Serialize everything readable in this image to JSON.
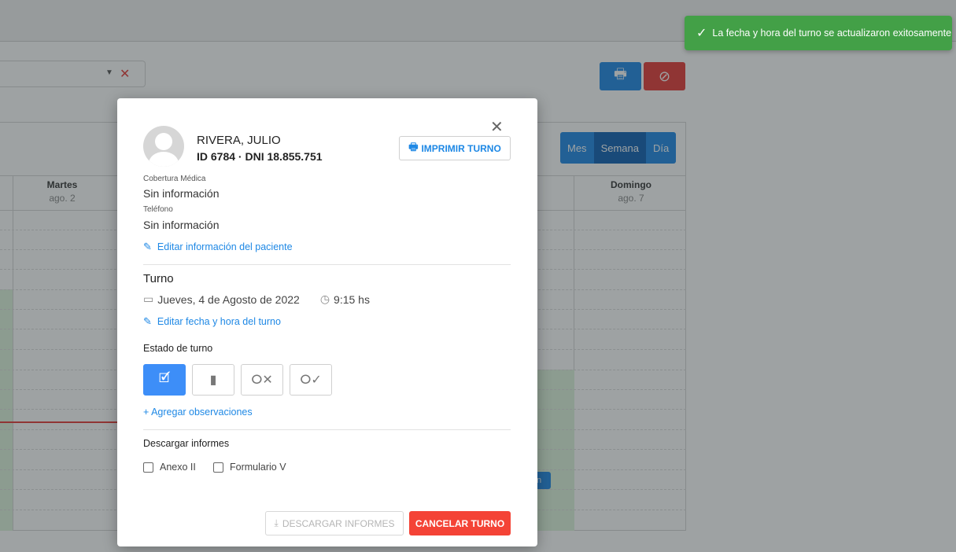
{
  "toast": {
    "message": "La fecha y hora del turno se actualizaron exitosamente",
    "icon": "check-icon",
    "color": "#43a047"
  },
  "background": {
    "view_tabs": [
      "Mes",
      "Semana",
      "Día"
    ],
    "active_view": "Semana",
    "days": [
      {
        "name": "Martes",
        "date": "ago. 2"
      },
      {
        "name": "Domingo",
        "date": "ago. 7"
      }
    ],
    "event_label": "n"
  },
  "modal": {
    "patient": {
      "name": "RIVERA, JULIO",
      "id_line": "ID 6784 · DNI 18.855.751"
    },
    "print_button": "IMPRIMIR TURNO",
    "coverage_label": "Cobertura Médica",
    "coverage_value": "Sin información",
    "phone_label": "Teléfono",
    "phone_value": "Sin información",
    "edit_patient_link": "Editar información del paciente",
    "turno": {
      "title": "Turno",
      "date": "Jueves, 4 de Agosto de 2022",
      "time": "9:15 hs",
      "edit_link": "Editar fecha y hora del turno"
    },
    "estado": {
      "title": "Estado de turno",
      "buttons": [
        {
          "icon": "calendar-check-icon",
          "active": true
        },
        {
          "icon": "door-icon",
          "active": false
        },
        {
          "icon": "user-x-icon",
          "active": false
        },
        {
          "icon": "user-check-icon",
          "active": false
        }
      ]
    },
    "add_obs_link": "+ Agregar observaciones",
    "informes": {
      "title": "Descargar informes",
      "options": [
        "Anexo II",
        "Formulario V"
      ]
    },
    "download_button": "DESCARGAR INFORMES",
    "cancel_button": "CANCELAR TURNO"
  },
  "colors": {
    "primary": "#1e88e5",
    "danger": "#f44336",
    "active_estado": "#3d8ef8"
  }
}
